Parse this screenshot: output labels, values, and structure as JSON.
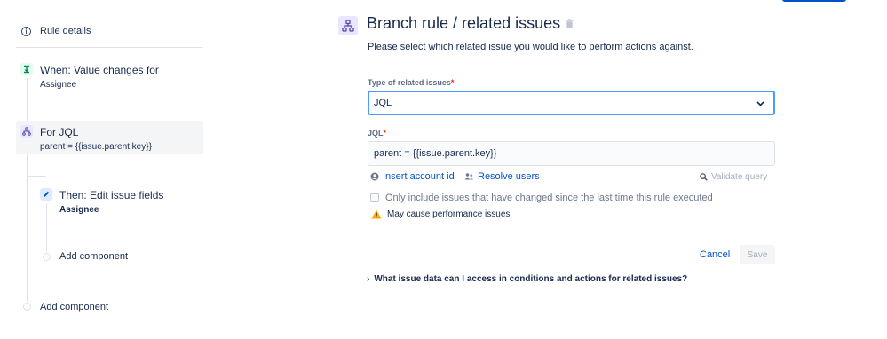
{
  "sidebar": {
    "rule_details": "Rule details",
    "components": [
      {
        "type": "trigger",
        "title": "When: Value changes for",
        "subtitle": "Assignee",
        "icon": "trigger-icon"
      },
      {
        "type": "branch",
        "title": "For JQL",
        "subtitle": "parent = {{issue.parent.key}}",
        "icon": "branch-icon",
        "selected": true
      },
      {
        "type": "action",
        "title": "Then: Edit issue fields",
        "subtitle": "Assignee",
        "icon": "pencil-icon"
      }
    ],
    "add_component_nested": "Add component",
    "add_component_root": "Add component"
  },
  "main": {
    "title": "Branch rule / related issues",
    "description": "Please select which related issue you would like to perform actions against.",
    "type_field": {
      "label": "Type of related issues",
      "required_marker": "*",
      "selected": "JQL"
    },
    "jql_field": {
      "label": "JQL",
      "required_marker": "*",
      "value": "parent = {{issue.parent.key}}"
    },
    "helpers": {
      "insert_account_id": "Insert account id",
      "resolve_users": "Resolve users",
      "validate_query": "Validate query"
    },
    "checkbox": {
      "label": "Only include issues that have changed since the last time this rule executed",
      "checked": false
    },
    "warning": "May cause performance issues",
    "buttons": {
      "cancel": "Cancel",
      "save": "Save"
    },
    "faq": {
      "chevron": "›",
      "label": "What issue data can I access in conditions and actions for related issues?"
    }
  },
  "colors": {
    "primary": "#0052CC",
    "text": "#172B4D",
    "focus_border": "#4C9AFF",
    "required": "#DE350B",
    "warning": "#FFAB00",
    "trigger_bg": "#E3FCEF",
    "branch_bg": "#EAE6FF",
    "action_bg": "#DEEBFF"
  }
}
